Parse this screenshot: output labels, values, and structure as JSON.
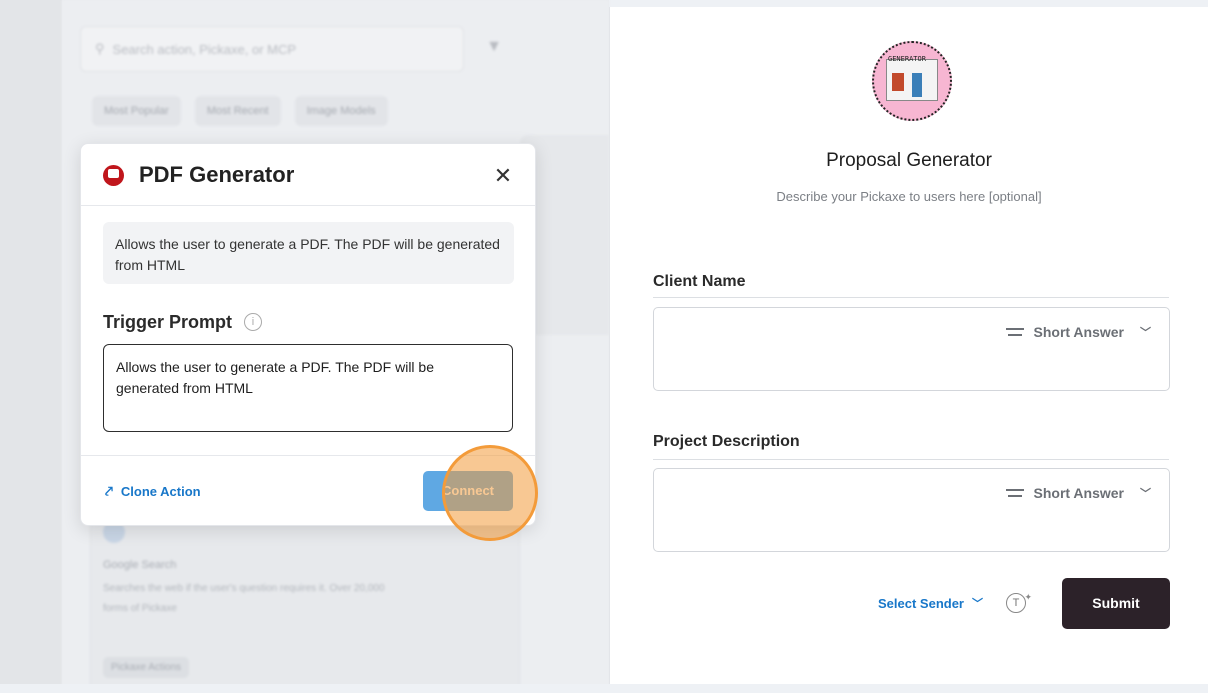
{
  "background_panel": {
    "search_placeholder": "Search action, Pickaxe, or MCP",
    "chips": [
      "Most Popular",
      "Most Recent",
      "Image Models"
    ],
    "card": {
      "title": "Google Search",
      "description": "Searches the web if the user's question requires it. Over 20,000 forms of Pickaxe",
      "badge": "Pickaxe Actions"
    }
  },
  "modal": {
    "title": "PDF Generator",
    "close_label": "✕",
    "description": "Allows the user to generate a PDF. The PDF will be generated from HTML",
    "trigger_label": "Trigger Prompt",
    "trigger_value": "Allows the user to generate a PDF. The PDF will be generated from HTML",
    "clone_label": "Clone Action",
    "connect_label": "Connect"
  },
  "form": {
    "title": "Proposal Generator",
    "description": "Describe your Pickaxe to users here [optional]",
    "fields": [
      {
        "label": "Client Name",
        "type": "Short Answer"
      },
      {
        "label": "Project Description",
        "type": "Short Answer"
      }
    ],
    "select_sender_label": "Select Sender",
    "submit_label": "Submit",
    "avatar_text": "GENERATOR"
  },
  "colors": {
    "accent_blue": "#1877c9",
    "connect_button": "#5fa8e3",
    "submit_button": "#2c2229",
    "pdf_icon": "#c0161c",
    "click_highlight": "#f39b3a"
  }
}
